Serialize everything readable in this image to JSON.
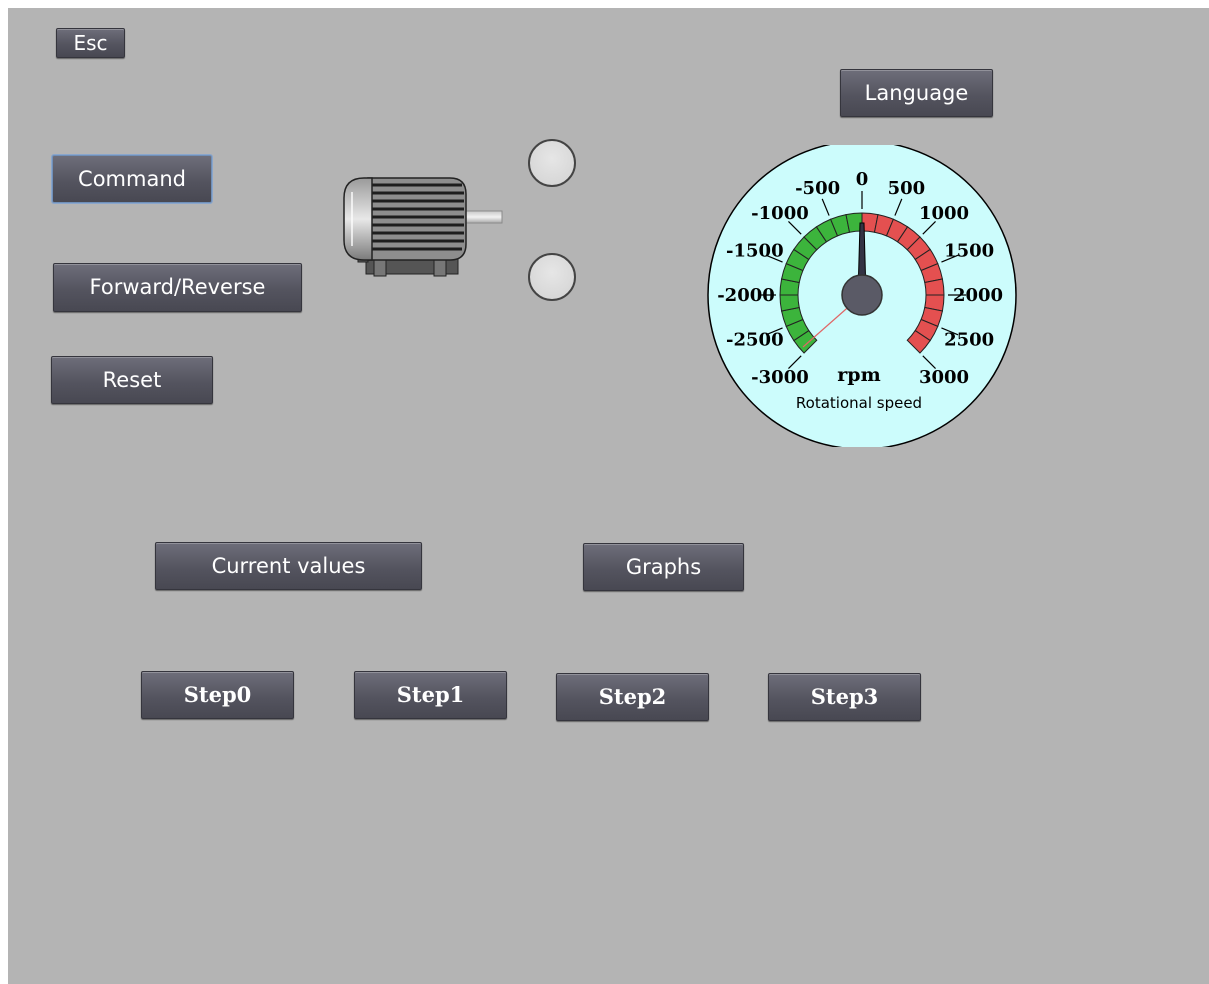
{
  "buttons": {
    "esc": "Esc",
    "command": "Command",
    "forward_reverse": "Forward/Reverse",
    "reset": "Reset",
    "language": "Language",
    "current_values": "Current values",
    "graphs": "Graphs",
    "step0": "Step0",
    "step1": "Step1",
    "step2": "Step2",
    "step3": "Step3"
  },
  "gauge": {
    "unit": "rpm",
    "caption": "Rotational speed",
    "min": -3000,
    "max": 3000,
    "value": 0,
    "tick_labels": [
      "-3000",
      "-2500",
      "-2000",
      "-1500",
      "-1000",
      "-500",
      "0",
      "500",
      "1000",
      "1500",
      "2000",
      "2500",
      "3000"
    ],
    "colors": {
      "face": "#ccfcfc",
      "negative_band": "#3cb43c",
      "positive_band": "#e45050",
      "hub": "#5a5a66"
    }
  },
  "colors": {
    "background": "#b4b4b4",
    "button": "#54545f"
  }
}
